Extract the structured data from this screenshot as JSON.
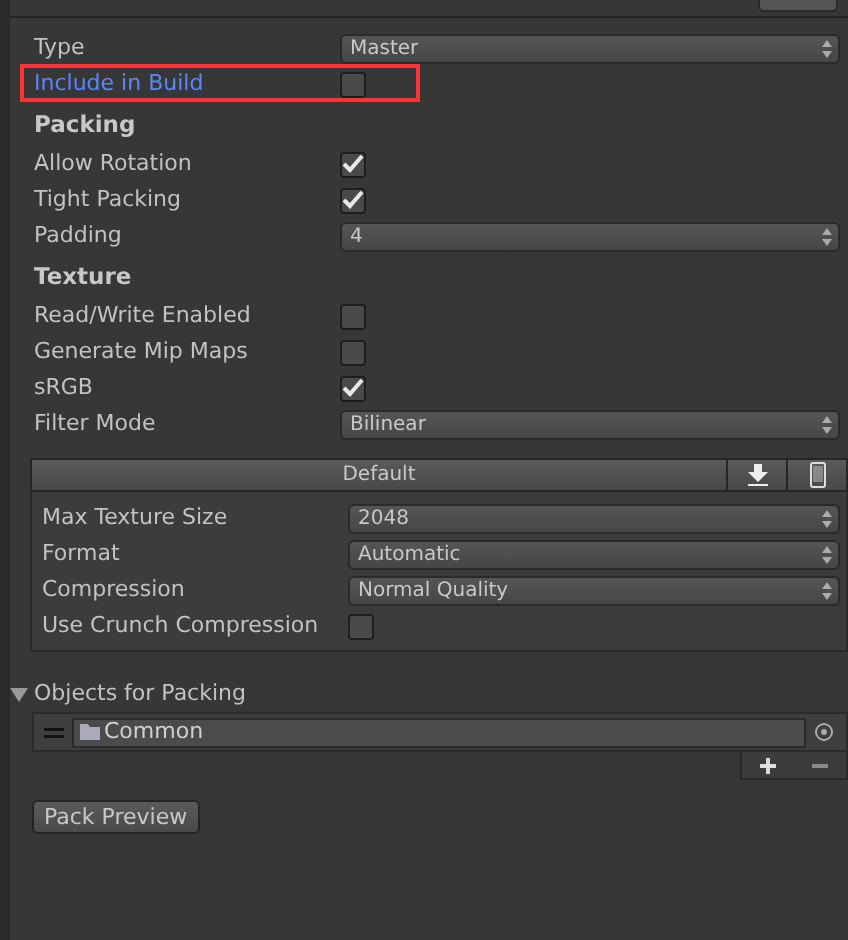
{
  "top_rows": [
    {
      "kind": "dropdown",
      "label": "Type",
      "value": "Master"
    },
    {
      "kind": "checkbox",
      "label": "Include in Build",
      "checked": false,
      "highlighted": true
    },
    {
      "kind": "heading",
      "label": "Packing"
    },
    {
      "kind": "checkbox",
      "label": "Allow Rotation",
      "checked": true
    },
    {
      "kind": "checkbox",
      "label": "Tight Packing",
      "checked": true
    },
    {
      "kind": "dropdown",
      "label": "Padding",
      "value": "4"
    },
    {
      "kind": "heading",
      "label": "Texture"
    },
    {
      "kind": "checkbox",
      "label": "Read/Write Enabled",
      "checked": false
    },
    {
      "kind": "checkbox",
      "label": "Generate Mip Maps",
      "checked": false
    },
    {
      "kind": "checkbox",
      "label": "sRGB",
      "checked": true
    },
    {
      "kind": "dropdown",
      "label": "Filter Mode",
      "value": "Bilinear"
    }
  ],
  "platform_panel": {
    "tab": "Default",
    "rows": [
      {
        "kind": "dropdown",
        "label": "Max Texture Size",
        "value": "2048"
      },
      {
        "kind": "dropdown",
        "label": "Format",
        "value": "Automatic"
      },
      {
        "kind": "dropdown",
        "label": "Compression",
        "value": "Normal Quality"
      },
      {
        "kind": "checkbox",
        "label": "Use Crunch Compression",
        "checked": false
      }
    ]
  },
  "objects_for_packing": {
    "title": "Objects for Packing",
    "expanded": true,
    "items": [
      {
        "name": "Common"
      }
    ]
  },
  "pack_preview_button": "Pack Preview"
}
